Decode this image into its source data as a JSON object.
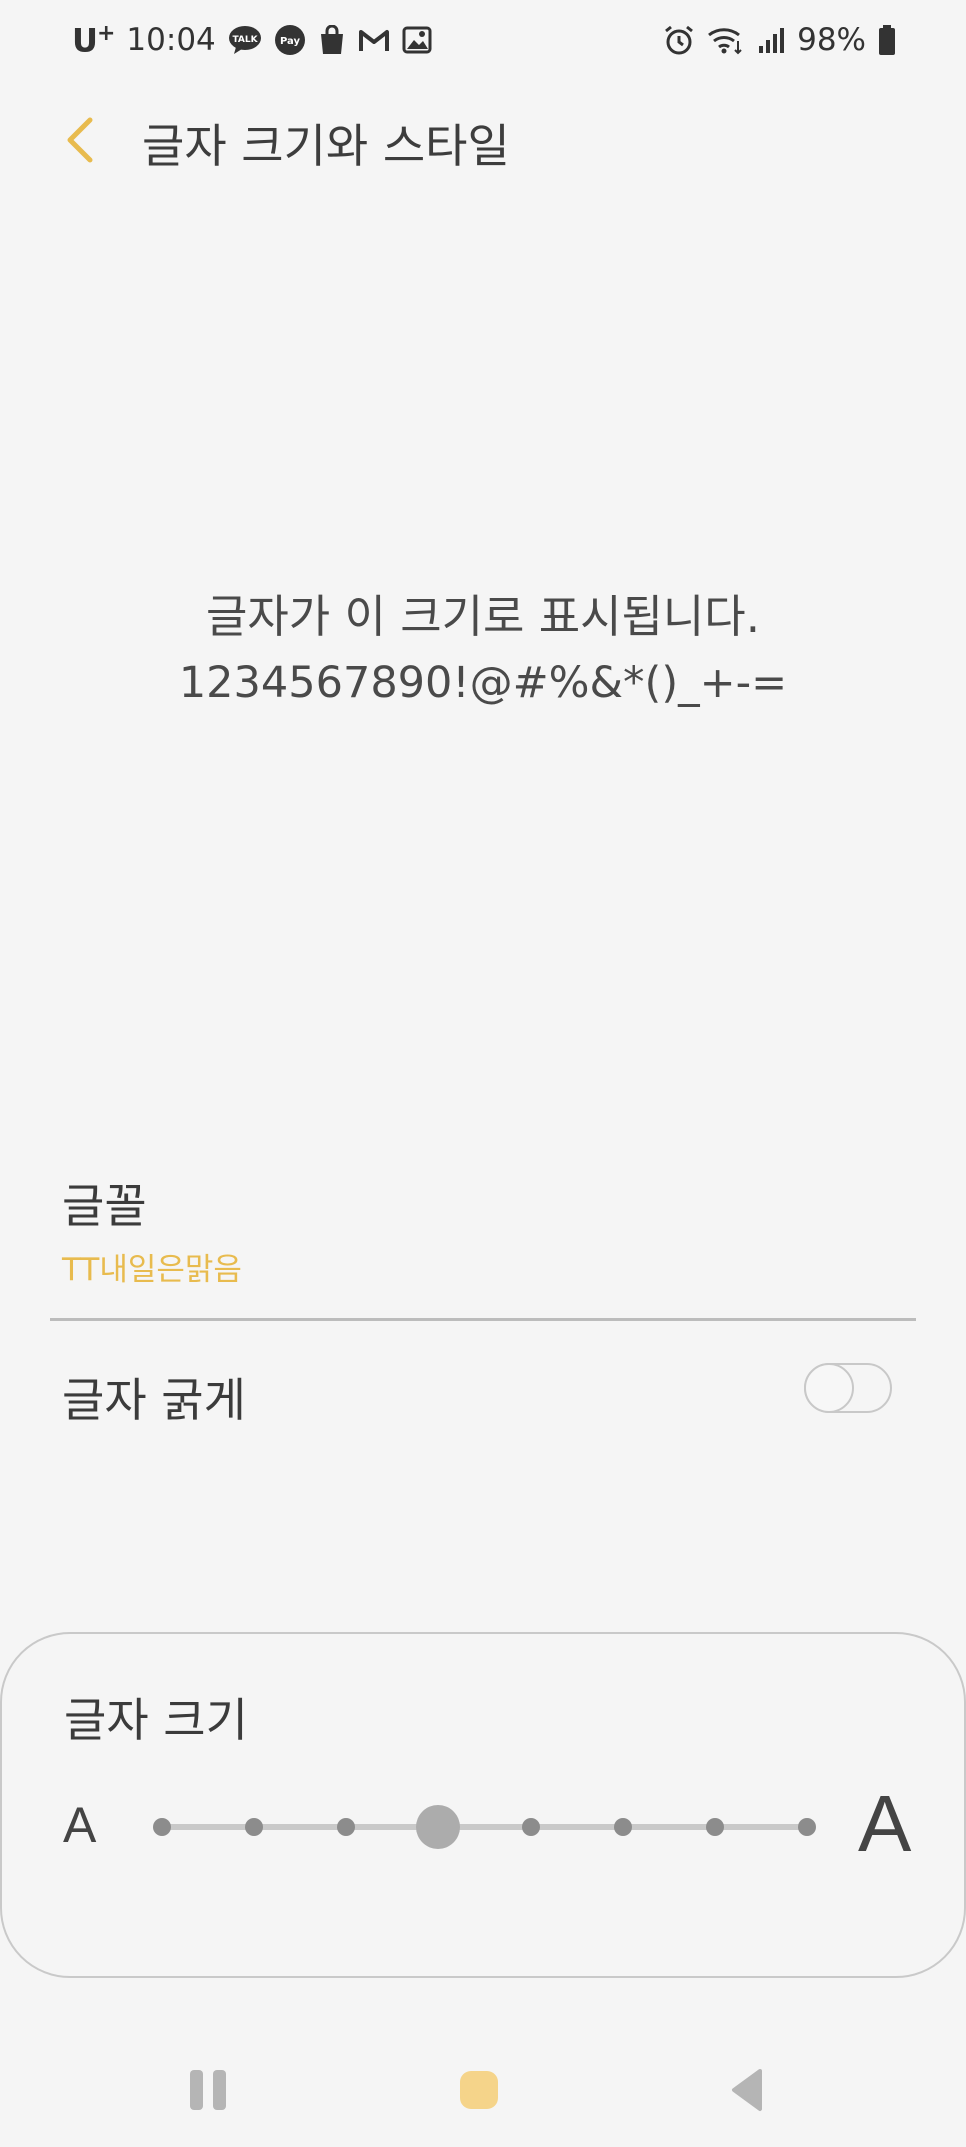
{
  "status_bar": {
    "carrier": "U",
    "carrier_sup": "+",
    "time": "10:04",
    "notification_icons": [
      "kakaotalk-icon",
      "kakaopay-icon",
      "shopping-bag-icon",
      "gmail-icon",
      "gallery-icon"
    ],
    "kakaotalk_text": "TALK",
    "kakaopay_text": "Pay",
    "system_icons": [
      "alarm-icon",
      "wifi-icon",
      "signal-icon"
    ],
    "battery_percent": "98%"
  },
  "header": {
    "back_icon": "chevron-left-icon",
    "title": "글자 크기와 스타일",
    "accent_color": "#e8bb4e"
  },
  "preview": {
    "line1": "글자가 이 크기로 표시됩니다.",
    "line2": "1234567890!@#%&*()_+-="
  },
  "font_setting": {
    "label": "글꼴",
    "value": "TT내일은맑음",
    "value_color": "#e8bb4e"
  },
  "bold_setting": {
    "label": "글자 굵게",
    "enabled": false
  },
  "size_setting": {
    "title": "글자 크기",
    "min_label": "A",
    "max_label": "A",
    "steps": 8,
    "selected_step": 4
  },
  "nav_bar": {
    "buttons": [
      "recent-apps-icon",
      "home-icon",
      "back-icon"
    ],
    "home_color": "#f5d48a"
  }
}
